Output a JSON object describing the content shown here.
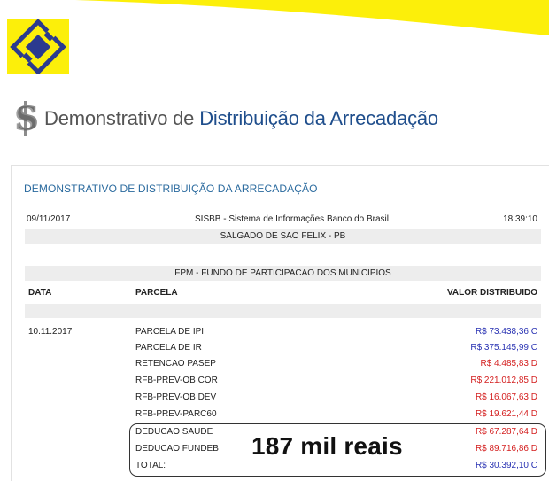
{
  "page": {
    "title_part1": "Demonstrativo de",
    "title_part2": "Distribuição da Arrecadação"
  },
  "panel": {
    "title": "DEMONSTRATIVO DE DISTRIBUIÇÃO DA ARRECADAÇÃO",
    "date": "09/11/2017",
    "system": "SISBB - Sistema de Informações Banco do Brasil",
    "time": "18:39:10",
    "municipality": "SALGADO DE SAO FELIX - PB",
    "fund": "FPM - FUNDO DE PARTICIPACAO DOS MUNICIPIOS",
    "columns": {
      "data": "DATA",
      "parcela": "PARCELA",
      "valor": "VALOR DISTRIBUIDO"
    },
    "entries": [
      {
        "date": "10.11.2017",
        "label": "PARCELA DE IPI",
        "value": "R$ 73.438,36 C",
        "type": "C"
      },
      {
        "date": "",
        "label": "PARCELA DE IR",
        "value": "R$ 375.145,99 C",
        "type": "C"
      },
      {
        "date": "",
        "label": "RETENCAO PASEP",
        "value": "R$ 4.485,83 D",
        "type": "D"
      },
      {
        "date": "",
        "label": "RFB-PREV-OB COR",
        "value": "R$ 221.012,85 D",
        "type": "D"
      },
      {
        "date": "",
        "label": "RFB-PREV-OB DEV",
        "value": "R$ 16.067,63 D",
        "type": "D"
      },
      {
        "date": "",
        "label": "RFB-PREV-PARC60",
        "value": "R$ 19.621,44 D",
        "type": "D"
      },
      {
        "date": "",
        "label": "DEDUCAO SAUDE",
        "value": "R$ 67.287,64 D",
        "type": "D"
      },
      {
        "date": "",
        "label": "DEDUCAO FUNDEB",
        "value": "R$ 89.716,86 D",
        "type": "D"
      },
      {
        "date": "",
        "label": "TOTAL:",
        "value": "R$ 30.392,10 C",
        "type": "C"
      }
    ]
  },
  "overlay": {
    "text": "187 mil reais"
  },
  "colors": {
    "brand_yellow": "#fcef0a",
    "brand_blue": "#2b3a8f",
    "credit": "#2a33b3",
    "debit": "#d42020"
  }
}
